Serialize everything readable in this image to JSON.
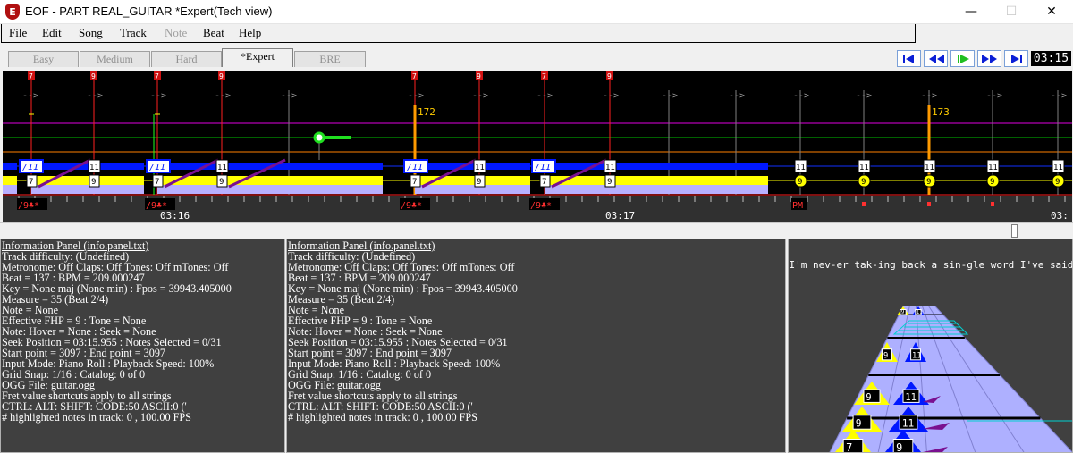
{
  "window": {
    "title": "EOF - PART REAL_GUITAR  *Expert(Tech view)",
    "minimize": "—",
    "maximize": "☐",
    "close": "✕"
  },
  "menu": {
    "items": [
      {
        "first": "F",
        "rest": "ile",
        "disabled": false
      },
      {
        "first": "E",
        "rest": "dit",
        "disabled": false
      },
      {
        "first": "S",
        "rest": "ong",
        "disabled": false
      },
      {
        "first": "T",
        "rest": "rack",
        "disabled": false
      },
      {
        "first": "N",
        "rest": "ote",
        "disabled": true
      },
      {
        "first": "B",
        "rest": "eat",
        "disabled": false
      },
      {
        "first": "H",
        "rest": "elp",
        "disabled": false
      }
    ]
  },
  "tabs": [
    {
      "label": "Easy",
      "active": false
    },
    {
      "label": "Medium",
      "active": false
    },
    {
      "label": "Hard",
      "active": false
    },
    {
      "label": "*Expert",
      "active": true
    },
    {
      "label": "BRE",
      "active": false
    }
  ],
  "transport": {
    "buttons": [
      "seek-start",
      "rewind",
      "play",
      "fast-forward",
      "seek-end"
    ],
    "time": "03:15",
    "accent": "#0b1fd6",
    "play_color": "#1fbf20"
  },
  "roll": {
    "beat_arrow": "-->",
    "bpm_markers": [
      "172",
      "173"
    ],
    "note_labels": {
      "chord_label": "/11",
      "fret_11": "11",
      "fret_9": "9",
      "fret_7": "7",
      "top_7": "7",
      "top_9": "9",
      "bottom_chord": "/9♣*",
      "bottom_pm": "PM"
    },
    "timestamps": [
      "03:16",
      "03:17",
      "03:"
    ],
    "colors": {
      "string_yellow": "#ffff00",
      "string_blue": "#0018ff",
      "string_purple": "#b8b0ff",
      "slide": "#7a1090",
      "marker_red": "#ff2020"
    }
  },
  "info_panels": [
    {
      "lines": [
        "Information Panel (info.panel.txt)",
        "Track difficulty: (Undefined)",
        "Metronome: Off Claps: Off Tones: Off mTones: Off",
        "Beat = 137 : BPM = 209.000247",
        "Key = None maj (None min) : Fpos = 39943.405000",
        "Measure = 35 (Beat 2/4)",
        "Note = None",
        "Effective FHP = 9 : Tone = None",
        "Note: Hover = None : Seek = None",
        "Seek Position = 03:15.955 : Notes Selected = 0/31",
        "Start point = 3097 : End point = 3097",
        "Input Mode: Piano Roll : Playback Speed: 100%",
        "Grid Snap: 1/16 : Catalog: 0 of 0",
        "OGG File: guitar.ogg",
        "Fret value shortcuts apply to all strings",
        "CTRL:   ALT:   SHIFT:   CODE:50  ASCII:0 ('",
        "# highlighted notes in track: 0 , 100.00 FPS"
      ]
    },
    {
      "lines": [
        "Information Panel (info.panel.txt)",
        "Track difficulty: (Undefined)",
        "Metronome: Off Claps: Off Tones: Off mTones: Off",
        "Beat = 137 : BPM = 209.000247",
        "Key = None maj (None min) : Fpos = 39943.405000",
        "Measure = 35 (Beat 2/4)",
        "Note = None",
        "Effective FHP = 9 : Tone = None",
        "Note: Hover = None : Seek = None",
        "Seek Position = 03:15.955 : Notes Selected = 0/31",
        "Start point = 3097 : End point = 3097",
        "Input Mode: Piano Roll : Playback Speed: 100%",
        "Grid Snap: 1/16 : Catalog: 0 of 0",
        "OGG File: guitar.ogg",
        "Fret value shortcuts apply to all strings",
        "CTRL:   ALT:   SHIFT:   CODE:50  ASCII:0 ('",
        "# highlighted notes in track: 0 , 100.00 FPS"
      ]
    }
  ],
  "preview": {
    "lyric": "I'm nev-er tak-ing back a sin-gle word I've said",
    "gems": {
      "g9": "9",
      "g11": "11",
      "g7": "7"
    }
  }
}
